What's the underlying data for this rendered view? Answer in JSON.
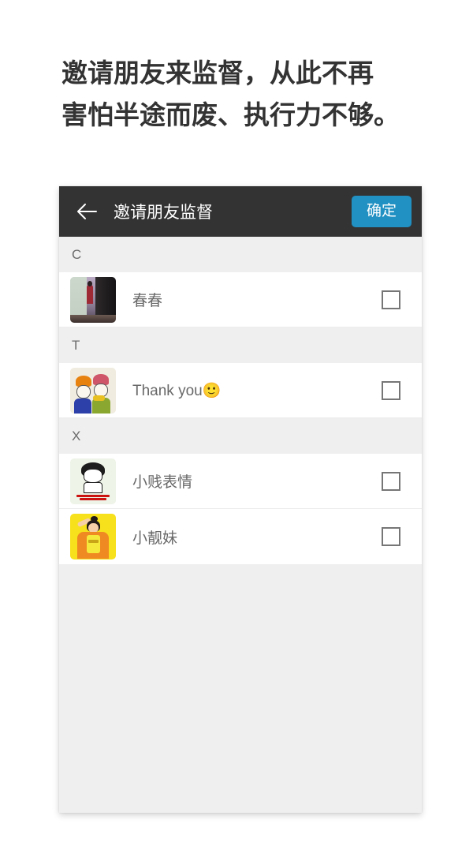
{
  "headline": "邀请朋友来监督，从此不再\n害怕半途而废、执行力不够。",
  "appbar": {
    "back_icon": "arrow-left-icon",
    "title": "邀请朋友监督",
    "confirm_label": "确定",
    "background_color": "#333333",
    "confirm_color": "#2190c2"
  },
  "list": {
    "sections": [
      {
        "letter": "C",
        "contacts": [
          {
            "name": "春春",
            "avatar": "photo-doorway",
            "checked": false
          }
        ]
      },
      {
        "letter": "T",
        "contacts": [
          {
            "name": "Thank you🙂",
            "avatar": "cartoon-two-figures",
            "checked": false
          }
        ]
      },
      {
        "letter": "X",
        "contacts": [
          {
            "name": "小贱表情",
            "avatar": "meme-drawing",
            "checked": false
          },
          {
            "name": "小靓妹",
            "avatar": "cartoon-girl-yellow",
            "checked": false
          }
        ]
      }
    ]
  },
  "colors": {
    "page_background": "#ffffff",
    "card_background": "#efefef",
    "row_background": "#ffffff",
    "section_header_background": "#efefef",
    "headline_text": "#333333",
    "contact_name_text": "#686868",
    "section_letter_text": "#6b6b6b",
    "checkbox_border": "#767676"
  }
}
